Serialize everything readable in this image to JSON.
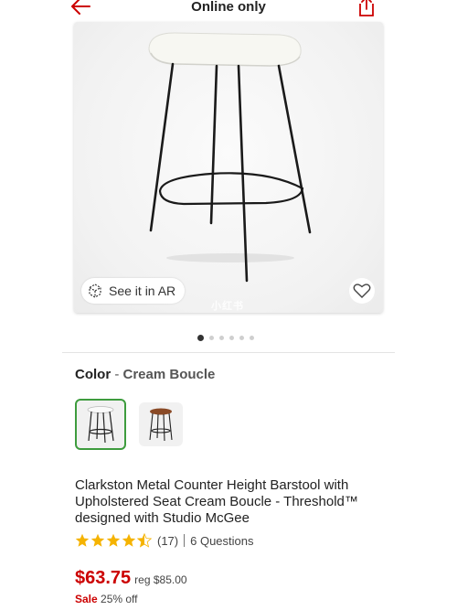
{
  "header": {
    "title": "Online only",
    "back_icon": "back-arrow-icon",
    "share_icon": "share-icon",
    "accent": "#cc0000"
  },
  "hero": {
    "ar_label": "See it in AR",
    "ar_icon": "ar-cube-icon",
    "favorite_icon": "heart-icon",
    "watermark": "小红书"
  },
  "carousel": {
    "count": 6,
    "active_index": 0
  },
  "color": {
    "key": "Color",
    "separator": "-",
    "value": "Cream Boucle",
    "selected_border": "#3e9c3e"
  },
  "product": {
    "title": "Clarkston Metal Counter Height Barstool with Upholstered Seat Cream Boucle - Threshold™ designed with Studio McGee",
    "rating": 4.5,
    "review_count": "(17)",
    "questions": "6 Questions",
    "star_color": "#f5b301"
  },
  "pricing": {
    "price": "$63.75",
    "reg": "reg $85.00",
    "sale_label": "Sale",
    "discount": "25% off",
    "price_color": "#cc0000"
  }
}
